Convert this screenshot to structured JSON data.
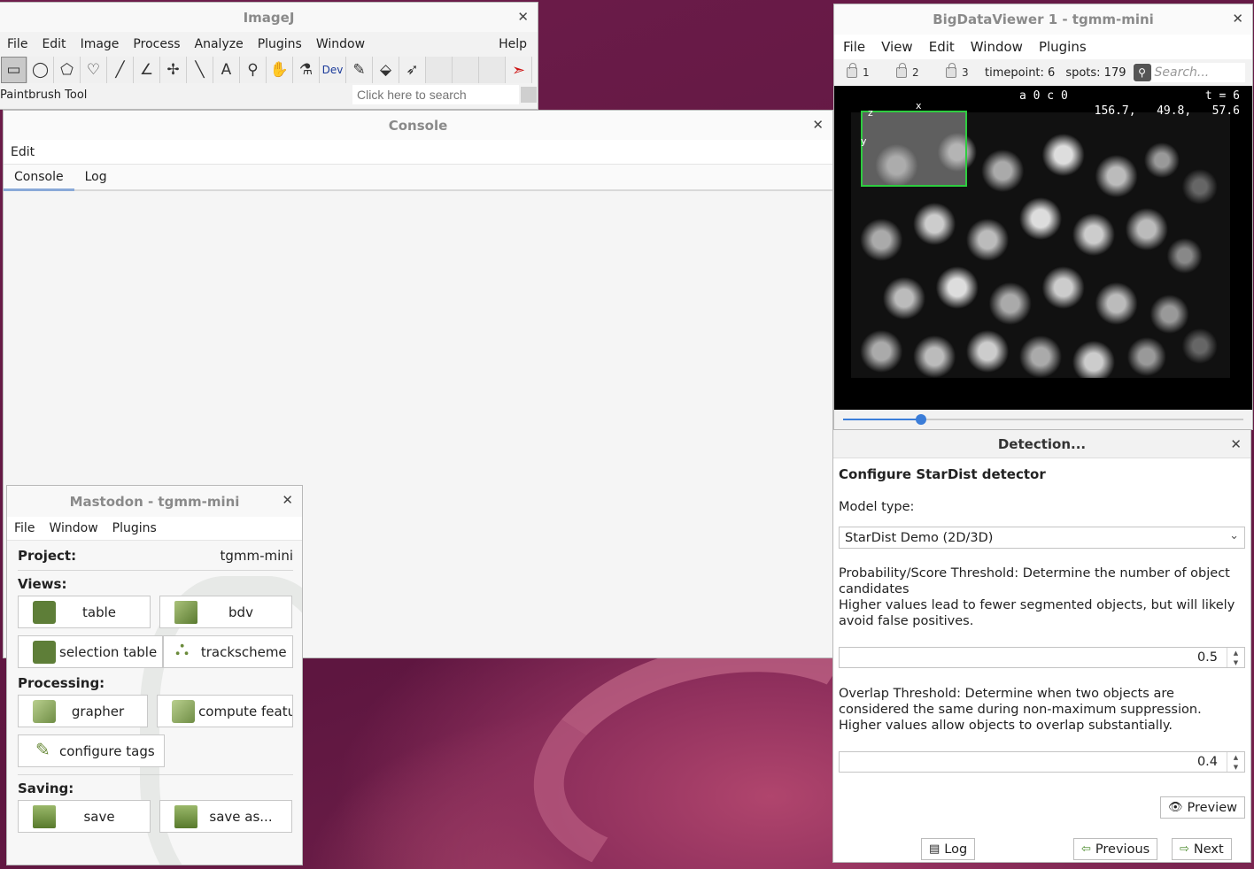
{
  "imagej": {
    "title": "ImageJ",
    "menu": [
      "File",
      "Edit",
      "Image",
      "Process",
      "Analyze",
      "Plugins",
      "Window"
    ],
    "help": "Help",
    "tools": [
      {
        "name": "rectangle-tool",
        "glyph": "▭",
        "active": true
      },
      {
        "name": "oval-tool",
        "glyph": "◯"
      },
      {
        "name": "polygon-tool",
        "glyph": "⬠"
      },
      {
        "name": "freehand-tool",
        "glyph": "♡"
      },
      {
        "name": "line-tool",
        "glyph": "╱"
      },
      {
        "name": "angle-tool",
        "glyph": "∠"
      },
      {
        "name": "point-tool",
        "glyph": "✢"
      },
      {
        "name": "wand-tool",
        "glyph": "╲"
      },
      {
        "name": "text-tool",
        "glyph": "A"
      },
      {
        "name": "magnifier-tool",
        "glyph": "⚲"
      },
      {
        "name": "hand-tool",
        "glyph": "✋"
      },
      {
        "name": "color-picker-tool",
        "glyph": "⚗"
      },
      {
        "name": "dev-tool",
        "glyph": "Dev",
        "dev": true
      },
      {
        "name": "paintbrush-tool",
        "glyph": "✎"
      },
      {
        "name": "flood-fill-tool",
        "glyph": "⬙"
      },
      {
        "name": "pencil-tool",
        "glyph": "➶"
      },
      {
        "name": "empty-tool-slot",
        "glyph": "",
        "empty": true
      },
      {
        "name": "empty-tool-slot",
        "glyph": "",
        "empty": true
      },
      {
        "name": "empty-tool-slot",
        "glyph": "",
        "empty": true
      },
      {
        "name": "more-tools-arrow",
        "glyph": "➣",
        "arrow": true
      }
    ],
    "status": "Paintbrush Tool",
    "search_placeholder": "Click here to search"
  },
  "console": {
    "title": "Console",
    "menu_edit": "Edit",
    "tabs": [
      "Console",
      "Log"
    ]
  },
  "mastodon": {
    "title": "Mastodon - tgmm-mini",
    "menu": [
      "File",
      "Window",
      "Plugins"
    ],
    "project_label": "Project:",
    "project_value": "tgmm-mini",
    "views_label": "Views:",
    "processing_label": "Processing:",
    "saving_label": "Saving:",
    "buttons": {
      "table": "table",
      "bdv": "bdv",
      "selection_table": "selection table",
      "trackscheme": "trackscheme",
      "grapher": "grapher",
      "compute_features": "compute featu",
      "configure_tags": "configure tags",
      "save": "save",
      "save_as": "save as..."
    }
  },
  "bdv": {
    "title": "BigDataViewer 1 - tgmm-mini",
    "menu": [
      "File",
      "View",
      "Edit",
      "Window",
      "Plugins"
    ],
    "locks": [
      "1",
      "2",
      "3"
    ],
    "timepoint": "timepoint: 6",
    "spots": "spots: 179",
    "search_placeholder": "Search...",
    "overlay_source": "a 0 c 0",
    "overlay_time": "t = 6",
    "overlay_coords": "156.7,   49.8,   57.6",
    "axis_x": "x",
    "axis_y": "y",
    "axis_z": "z",
    "timeline_fraction": 0.195
  },
  "detection": {
    "title": "Detection...",
    "heading": "Configure StarDist detector",
    "model_label": "Model type:",
    "model_value": "StarDist Demo (2D/3D)",
    "prob_text_1": "Probability/Score Threshold: Determine the number of object candidates",
    "prob_text_2": "Higher values lead to fewer segmented objects, but will likely avoid false positives.",
    "prob_value": "0.5",
    "overlap_text_1": "Overlap Threshold: Determine when two objects are considered the same during non-maximum suppression.",
    "overlap_text_2": "Higher values allow objects to overlap substantially.",
    "overlap_value": "0.4",
    "preview_label": "Preview",
    "log_label": "Log",
    "previous_label": "Previous",
    "next_label": "Next"
  }
}
